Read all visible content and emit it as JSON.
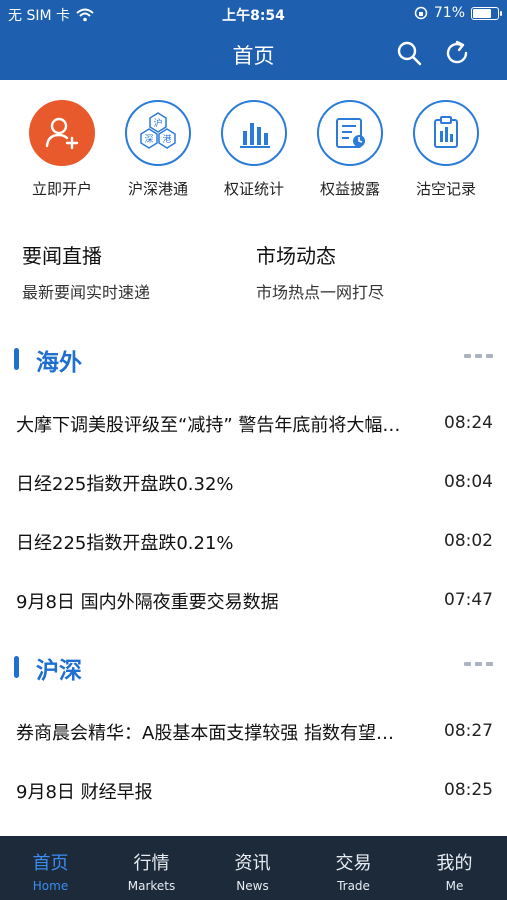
{
  "status_bar": {
    "carrier": "无 SIM 卡",
    "time": "上午8:54",
    "battery_percent": "71%",
    "battery_level": 0.71
  },
  "header": {
    "title": "首页",
    "search_icon": "search-icon",
    "refresh_icon": "refresh-icon"
  },
  "quick_actions": [
    {
      "label": "立即开户",
      "icon": "add-user-icon"
    },
    {
      "label": "沪深港通",
      "icon": "hk-sh-sz-connect-icon",
      "icon_text": [
        "沪",
        "深",
        "港"
      ]
    },
    {
      "label": "权证统计",
      "icon": "bar-chart-icon"
    },
    {
      "label": "权益披露",
      "icon": "disclosure-icon"
    },
    {
      "label": "沽空记录",
      "icon": "short-record-icon"
    }
  ],
  "features": [
    {
      "title": "要闻直播",
      "subtitle": "最新要闻实时速递"
    },
    {
      "title": "市场动态",
      "subtitle": "市场热点一网打尽"
    }
  ],
  "sections": [
    {
      "title": "海外",
      "items": [
        {
          "headline": "大摩下调美股评级至“减持” 警告年底前将大幅回调",
          "time": "08:24"
        },
        {
          "headline": "日经225指数开盘跌0.32%",
          "time": "08:04"
        },
        {
          "headline": "日经225指数开盘跌0.21%",
          "time": "08:02"
        },
        {
          "headline": "9月8日 国内外隔夜重要交易数据",
          "time": "07:47"
        }
      ]
    },
    {
      "title": "沪深",
      "items": [
        {
          "headline": "券商晨会精华：A股基本面支撑较强 指数有望企稳",
          "time": "08:27"
        },
        {
          "headline": "9月8日 财经早报",
          "time": "08:25"
        }
      ]
    }
  ],
  "tabs": [
    {
      "zh": "首页",
      "en": "Home",
      "active": true
    },
    {
      "zh": "行情",
      "en": "Markets",
      "active": false
    },
    {
      "zh": "资讯",
      "en": "News",
      "active": false
    },
    {
      "zh": "交易",
      "en": "Trade",
      "active": false
    },
    {
      "zh": "我的",
      "en": "Me",
      "active": false
    }
  ],
  "colors": {
    "header_blue": "#1e5fb0",
    "accent_blue": "#1e6fd0",
    "open_account_orange": "#e85a2c",
    "tabbar_bg": "#1c2a3a",
    "tab_active": "#3b8df0"
  }
}
